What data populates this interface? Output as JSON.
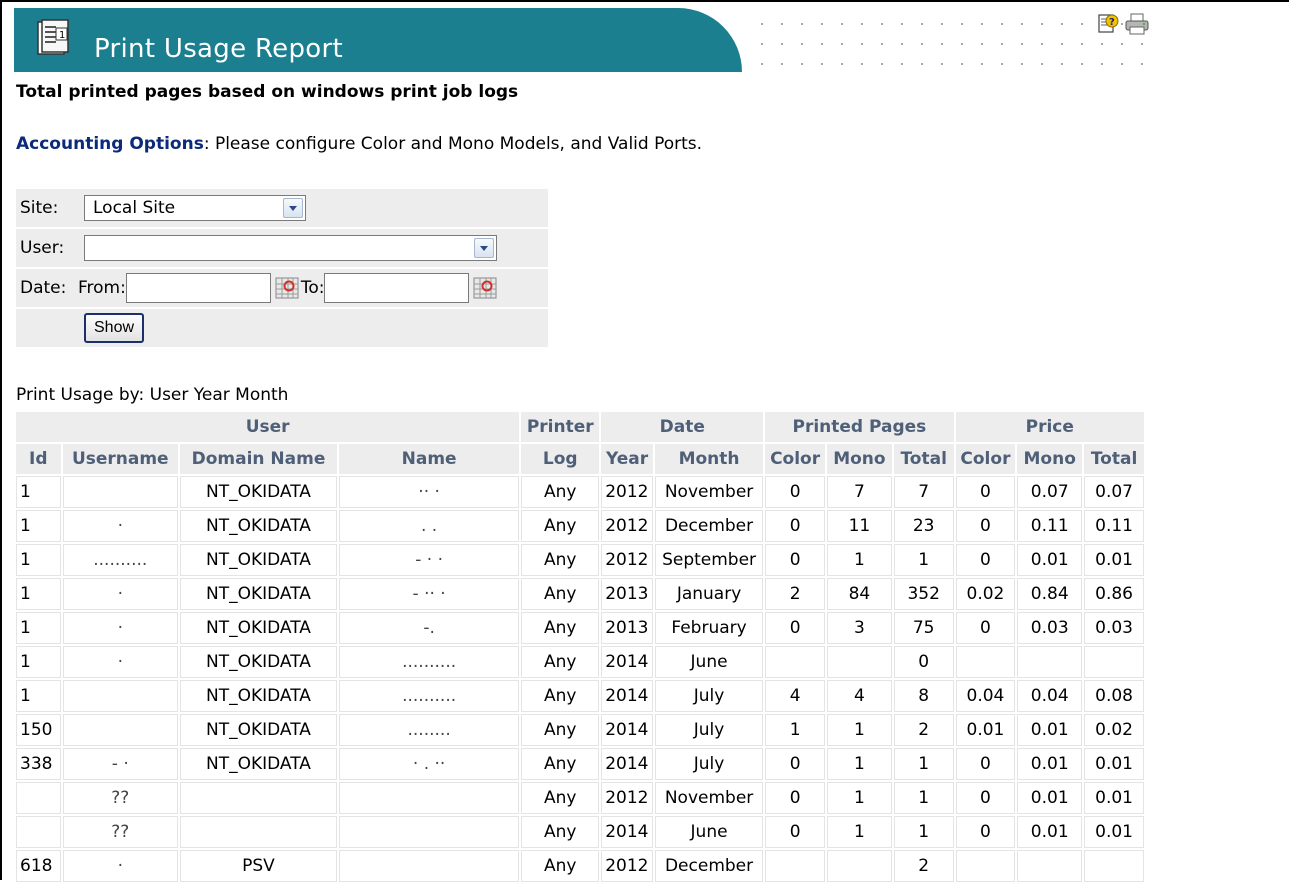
{
  "header": {
    "title": "Print Usage Report",
    "doc_icon_number": "1"
  },
  "subtitle": "Total printed pages based on windows print job logs",
  "accounting": {
    "link_label": "Accounting Options",
    "message": ": Please configure Color and Mono Models, and Valid Ports."
  },
  "filters": {
    "site_label": "Site:",
    "site_value": "Local Site",
    "user_label": "User:",
    "user_value": "",
    "date_label": "Date:",
    "from_label": "From:",
    "from_value": "",
    "to_label": "To:",
    "to_value": "",
    "show_label": "Show"
  },
  "usage_caption": "Print Usage by: User Year Month",
  "table": {
    "group_headers": {
      "user": "User",
      "printer": "Printer",
      "date": "Date",
      "printed_pages": "Printed Pages",
      "price": "Price"
    },
    "columns": {
      "id": "Id",
      "username": "Username",
      "domain": "Domain Name",
      "name": "Name",
      "log": "Log",
      "year": "Year",
      "month": "Month",
      "pp_color": "Color",
      "pp_mono": "Mono",
      "pp_total": "Total",
      "pr_color": "Color",
      "pr_mono": "Mono",
      "pr_total": "Total"
    },
    "rows": [
      {
        "id": "1",
        "username": "",
        "domain": "NT_OKIDATA",
        "name": "·· ·",
        "log": "Any",
        "year": "2012",
        "month": "November",
        "pp_color": "0",
        "pp_mono": "7",
        "pp_total": "7",
        "pr_color": "0",
        "pr_mono": "0.07",
        "pr_total": "0.07"
      },
      {
        "id": "1",
        "username": "·",
        "domain": "NT_OKIDATA",
        "name": ".        .",
        "log": "Any",
        "year": "2012",
        "month": "December",
        "pp_color": "0",
        "pp_mono": "11",
        "pp_total": "23",
        "pr_color": "0",
        "pr_mono": "0.11",
        "pr_total": "0.11"
      },
      {
        "id": "1",
        "username": "..........",
        "domain": "NT_OKIDATA",
        "name": "- · ·",
        "log": "Any",
        "year": "2012",
        "month": "September",
        "pp_color": "0",
        "pp_mono": "1",
        "pp_total": "1",
        "pr_color": "0",
        "pr_mono": "0.01",
        "pr_total": "0.01"
      },
      {
        "id": "1",
        "username": "·",
        "domain": "NT_OKIDATA",
        "name": "- ··  ·",
        "log": "Any",
        "year": "2013",
        "month": "January",
        "pp_color": "2",
        "pp_mono": "84",
        "pp_total": "352",
        "pr_color": "0.02",
        "pr_mono": "0.84",
        "pr_total": "0.86"
      },
      {
        "id": "1",
        "username": "·",
        "domain": "NT_OKIDATA",
        "name": "-.",
        "log": "Any",
        "year": "2013",
        "month": "February",
        "pp_color": "0",
        "pp_mono": "3",
        "pp_total": "75",
        "pr_color": "0",
        "pr_mono": "0.03",
        "pr_total": "0.03"
      },
      {
        "id": "1",
        "username": "·",
        "domain": "NT_OKIDATA",
        "name": "..........",
        "log": "Any",
        "year": "2014",
        "month": "June",
        "pp_color": "",
        "pp_mono": "",
        "pp_total": "0",
        "pr_color": "",
        "pr_mono": "",
        "pr_total": ""
      },
      {
        "id": "1",
        "username": "",
        "domain": "NT_OKIDATA",
        "name": "..........",
        "log": "Any",
        "year": "2014",
        "month": "July",
        "pp_color": "4",
        "pp_mono": "4",
        "pp_total": "8",
        "pr_color": "0.04",
        "pr_mono": "0.04",
        "pr_total": "0.08"
      },
      {
        "id": "150",
        "username": "",
        "domain": "NT_OKIDATA",
        "name": "........",
        "log": "Any",
        "year": "2014",
        "month": "July",
        "pp_color": "1",
        "pp_mono": "1",
        "pp_total": "2",
        "pr_color": "0.01",
        "pr_mono": "0.01",
        "pr_total": "0.02"
      },
      {
        "id": "338",
        "username": "- ·",
        "domain": "NT_OKIDATA",
        "name": "·  .       ··",
        "log": "Any",
        "year": "2014",
        "month": "July",
        "pp_color": "0",
        "pp_mono": "1",
        "pp_total": "1",
        "pr_color": "0",
        "pr_mono": "0.01",
        "pr_total": "0.01"
      },
      {
        "id": "",
        "username": "??",
        "domain": "",
        "name": "",
        "log": "Any",
        "year": "2012",
        "month": "November",
        "pp_color": "0",
        "pp_mono": "1",
        "pp_total": "1",
        "pr_color": "0",
        "pr_mono": "0.01",
        "pr_total": "0.01"
      },
      {
        "id": "",
        "username": "??",
        "domain": "",
        "name": "",
        "log": "Any",
        "year": "2014",
        "month": "June",
        "pp_color": "0",
        "pp_mono": "1",
        "pp_total": "1",
        "pr_color": "0",
        "pr_mono": "0.01",
        "pr_total": "0.01"
      },
      {
        "id": "618",
        "username": "·",
        "domain": "PSV",
        "name": "",
        "log": "Any",
        "year": "2012",
        "month": "December",
        "pp_color": "",
        "pp_mono": "",
        "pp_total": "2",
        "pr_color": "",
        "pr_mono": "",
        "pr_total": ""
      }
    ]
  }
}
